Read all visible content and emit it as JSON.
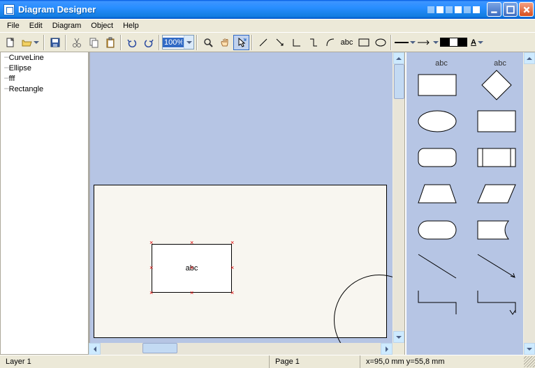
{
  "window": {
    "title": "Diagram Designer"
  },
  "menu": {
    "file": "File",
    "edit": "Edit",
    "diagram": "Diagram",
    "object": "Object",
    "help": "Help"
  },
  "toolbar": {
    "zoom": "100%",
    "abc": "abc",
    "txttool": "A"
  },
  "tree": {
    "items": [
      "CurveLine",
      "Ellipse",
      "fff",
      "Rectangle"
    ]
  },
  "canvas": {
    "shape_label": "abc"
  },
  "palette": {
    "hdr1": "abc",
    "hdr2": "abc"
  },
  "status": {
    "layer": "Layer 1",
    "page": "Page 1",
    "coords": "x=95,0 mm  y=55,8 mm"
  }
}
